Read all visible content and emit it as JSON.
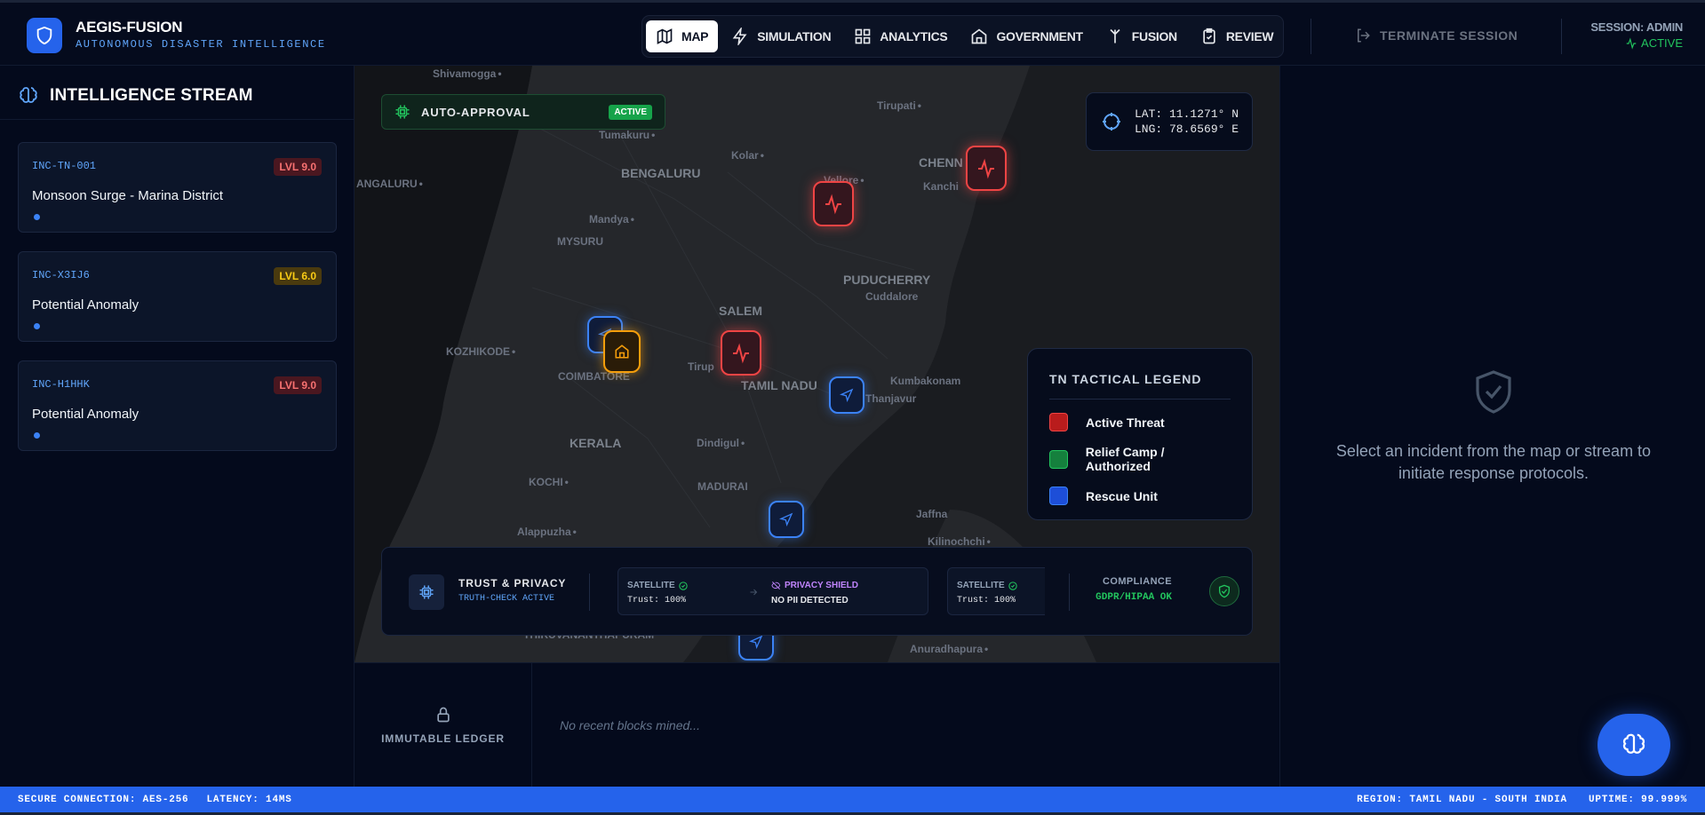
{
  "app": {
    "name": "AEGIS-FUSION",
    "subtitle": "AUTONOMOUS DISASTER INTELLIGENCE"
  },
  "nav": {
    "items": [
      {
        "label": "MAP",
        "icon": "map-icon",
        "active": true
      },
      {
        "label": "SIMULATION",
        "icon": "zap-icon",
        "active": false
      },
      {
        "label": "ANALYTICS",
        "icon": "grid-icon",
        "active": false
      },
      {
        "label": "GOVERNMENT",
        "icon": "home-icon",
        "active": false
      },
      {
        "label": "FUSION",
        "icon": "merge-icon",
        "active": false
      },
      {
        "label": "REVIEW",
        "icon": "clipboard-check-icon",
        "active": false
      }
    ]
  },
  "header": {
    "terminate_label": "TERMINATE SESSION",
    "session_label": "SESSION: ADMIN",
    "session_status": "ACTIVE"
  },
  "stream": {
    "title": "INTELLIGENCE STREAM",
    "incidents": [
      {
        "id": "INC-TN-001",
        "level": "LVL 9.0",
        "severity": "red",
        "title": "Monsoon Surge - Marina District"
      },
      {
        "id": "INC-X3IJ6",
        "level": "LVL 6.0",
        "severity": "yellow",
        "title": "Potential Anomaly"
      },
      {
        "id": "INC-H1HHK",
        "level": "LVL 9.0",
        "severity": "red",
        "title": "Potential Anomaly"
      }
    ]
  },
  "map": {
    "auto_approval": {
      "label": "AUTO-APPROVAL",
      "badge": "ACTIVE"
    },
    "coords": {
      "lat": "LAT: 11.1271° N",
      "lng": "LNG: 78.6569° E"
    },
    "places": {
      "shivamogga": "Shivamogga",
      "tumakuru": "Tumakuru",
      "tirupati": "Tirupati",
      "kolar": "Kolar",
      "bengaluru": "BENGALURU",
      "chennai": "CHENN",
      "vellore": "Vellore",
      "kanchi": "Kanchi",
      "angaluru": "ANGALURU",
      "mandya": "Mandya",
      "mysuru": "MYSURU",
      "puducherry": "PUDUCHERRY",
      "cuddalore": "Cuddalore",
      "salem": "SALEM",
      "kozhikode": "KOZHIKODE",
      "coimbatore": "COIMBATORE",
      "tirupur": "Tirup",
      "tamilnadu": "TAMIL NADU",
      "kumbakonam": "Kumbakonam",
      "thanjavur": "Thanjavur",
      "kerala": "KERALA",
      "dindigul": "Dindigul",
      "kochi": "KOCHI",
      "madurai": "MADURAI",
      "alappuzha": "Alappuzha",
      "jaffna": "Jaffna",
      "kilinochchi": "Kilinochchi",
      "thiruvananthapuram": "THIRUVANANTHAPURAM",
      "anuradhapura": "Anuradhapura"
    },
    "legend": {
      "title": "TN TACTICAL LEGEND",
      "items": [
        {
          "label": "Active Threat",
          "color": "#ef4444"
        },
        {
          "label": "Relief Camp / Authorized",
          "color": "#22c55e"
        },
        {
          "label": "Rescue Unit",
          "color": "#3b82f6"
        }
      ]
    },
    "trust": {
      "title": "TRUST & PRIVACY",
      "subtitle": "TRUTH-CHECK ACTIVE",
      "chip1_source": "SATELLITE",
      "chip1_trust": "Trust: 100%",
      "privacy_title": "PRIVACY SHIELD",
      "privacy_status": "NO PII DETECTED",
      "chip2_source": "SATELLITE",
      "chip2_trust": "Trust: 100%",
      "compliance_label": "COMPLIANCE",
      "compliance_value": "GDPR/HIPAA OK"
    }
  },
  "ledger": {
    "label": "IMMUTABLE LEDGER",
    "empty": "No recent blocks mined..."
  },
  "details": {
    "placeholder": "Select an incident from the map or stream to initiate response protocols."
  },
  "status": {
    "connection": "SECURE CONNECTION: AES-256",
    "latency": "LATENCY: 14MS",
    "region": "REGION: TAMIL NADU - SOUTH INDIA",
    "uptime": "UPTIME: 99.999%"
  },
  "colors": {
    "accent": "#2563eb",
    "threat": "#ef4444",
    "relief": "#22c55e",
    "rescue": "#3b82f6",
    "warning": "#f59e0b"
  }
}
